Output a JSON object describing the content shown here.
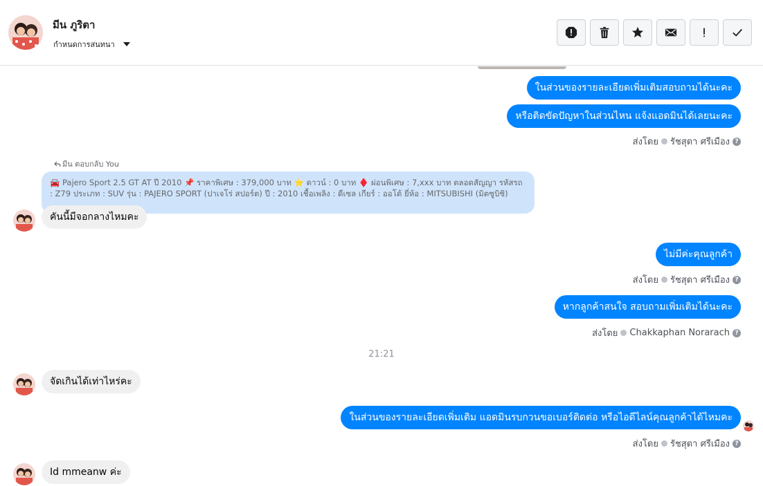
{
  "header": {
    "name": "มีน ภูริตา",
    "subtitle": "กำหนดการสนทนา",
    "toolbar": [
      "spam-icon",
      "trash-icon",
      "star-icon",
      "envelope-icon",
      "exclamation-icon",
      "check-icon"
    ]
  },
  "messages": {
    "out1": "ในส่วนของรายละเอียดเพิ่มเติมสอบถามได้นะคะ",
    "out2": "หรือติดขัดปัญหาในส่วนไหน แจ้งแอดมินได้เลยนะคะ",
    "sent_by_1_prefix": "ส่งโดย",
    "sent_by_1_name": "รัชสุดา ศรีเมือง",
    "reply_label": "มีน ตอบกลับ You",
    "quoted_text": "🚘 Pajero Sport 2.5 GT AT ปี 2010 📌 ราคาพิเศษ : 379,000 บาท ⭐ ดาวน์ : 0 บาท ♦️ ผ่อนพิเศษ : 7,xxx บาท ตลอดสัญญา รหัสรถ : Z79 ประเภท : SUV รุ่น : PAJERO SPORT (ปาเจโร่ สปอร์ต) ปี : 2010 เชื้อเพลิง : ดีเซล เกียร์ : ออโต้ ยี่ห้อ : MITSUBISHI (มิตซูบิชิ)",
    "in1": "คันนี้มีจอกลางไหมคะ",
    "out3": "ไม่มีค่ะคุณลูกค้า",
    "sent_by_2_prefix": "ส่งโดย",
    "sent_by_2_name": "รัชสุดา ศรีเมือง",
    "out4": "หากลูกค้าสนใจ สอบถามเพิ่มเติมได้นะคะ",
    "sent_by_3_prefix": "ส่งโดย",
    "sent_by_3_name": "Chakkaphan Norarach",
    "time": "21:21",
    "in2": "จัดเกินได้เท่าไหร่คะ",
    "out5": "ในส่วนของรายละเอียดเพิ่มเติม แอดมินรบกวนขอเบอร์ติดต่อ หรือไอดีไลน์คุณลูกค้าได้ไหมคะ",
    "sent_by_4_prefix": "ส่งโดย",
    "sent_by_4_name": "รัชสุดา ศรีเมือง",
    "in3": "Id mmeanw ค่ะ"
  },
  "colors": {
    "outgoing_bubble": "#0084ff",
    "incoming_bubble": "#f1f0f0",
    "quoted_bubble": "#cfe4fb"
  }
}
